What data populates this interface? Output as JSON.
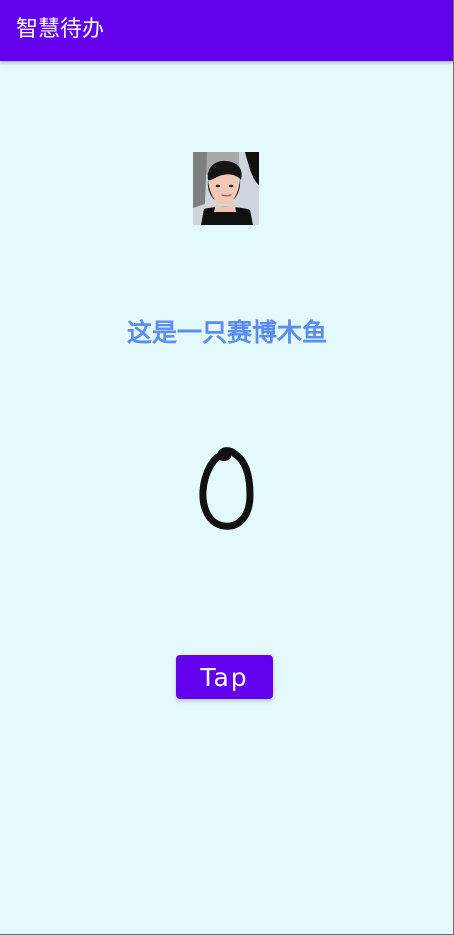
{
  "app_bar": {
    "title": "智慧待办",
    "background_color": "#6200ee",
    "text_color": "#ffffff"
  },
  "main": {
    "avatar": {
      "icon": "person-photo"
    },
    "heading": "这是一只赛博木鱼",
    "heading_color": "#5b8def",
    "counter": {
      "value": "0"
    },
    "tap_button": {
      "label": "Tap",
      "background_color": "#6200ee"
    }
  },
  "background_color": "#e4f9fc"
}
